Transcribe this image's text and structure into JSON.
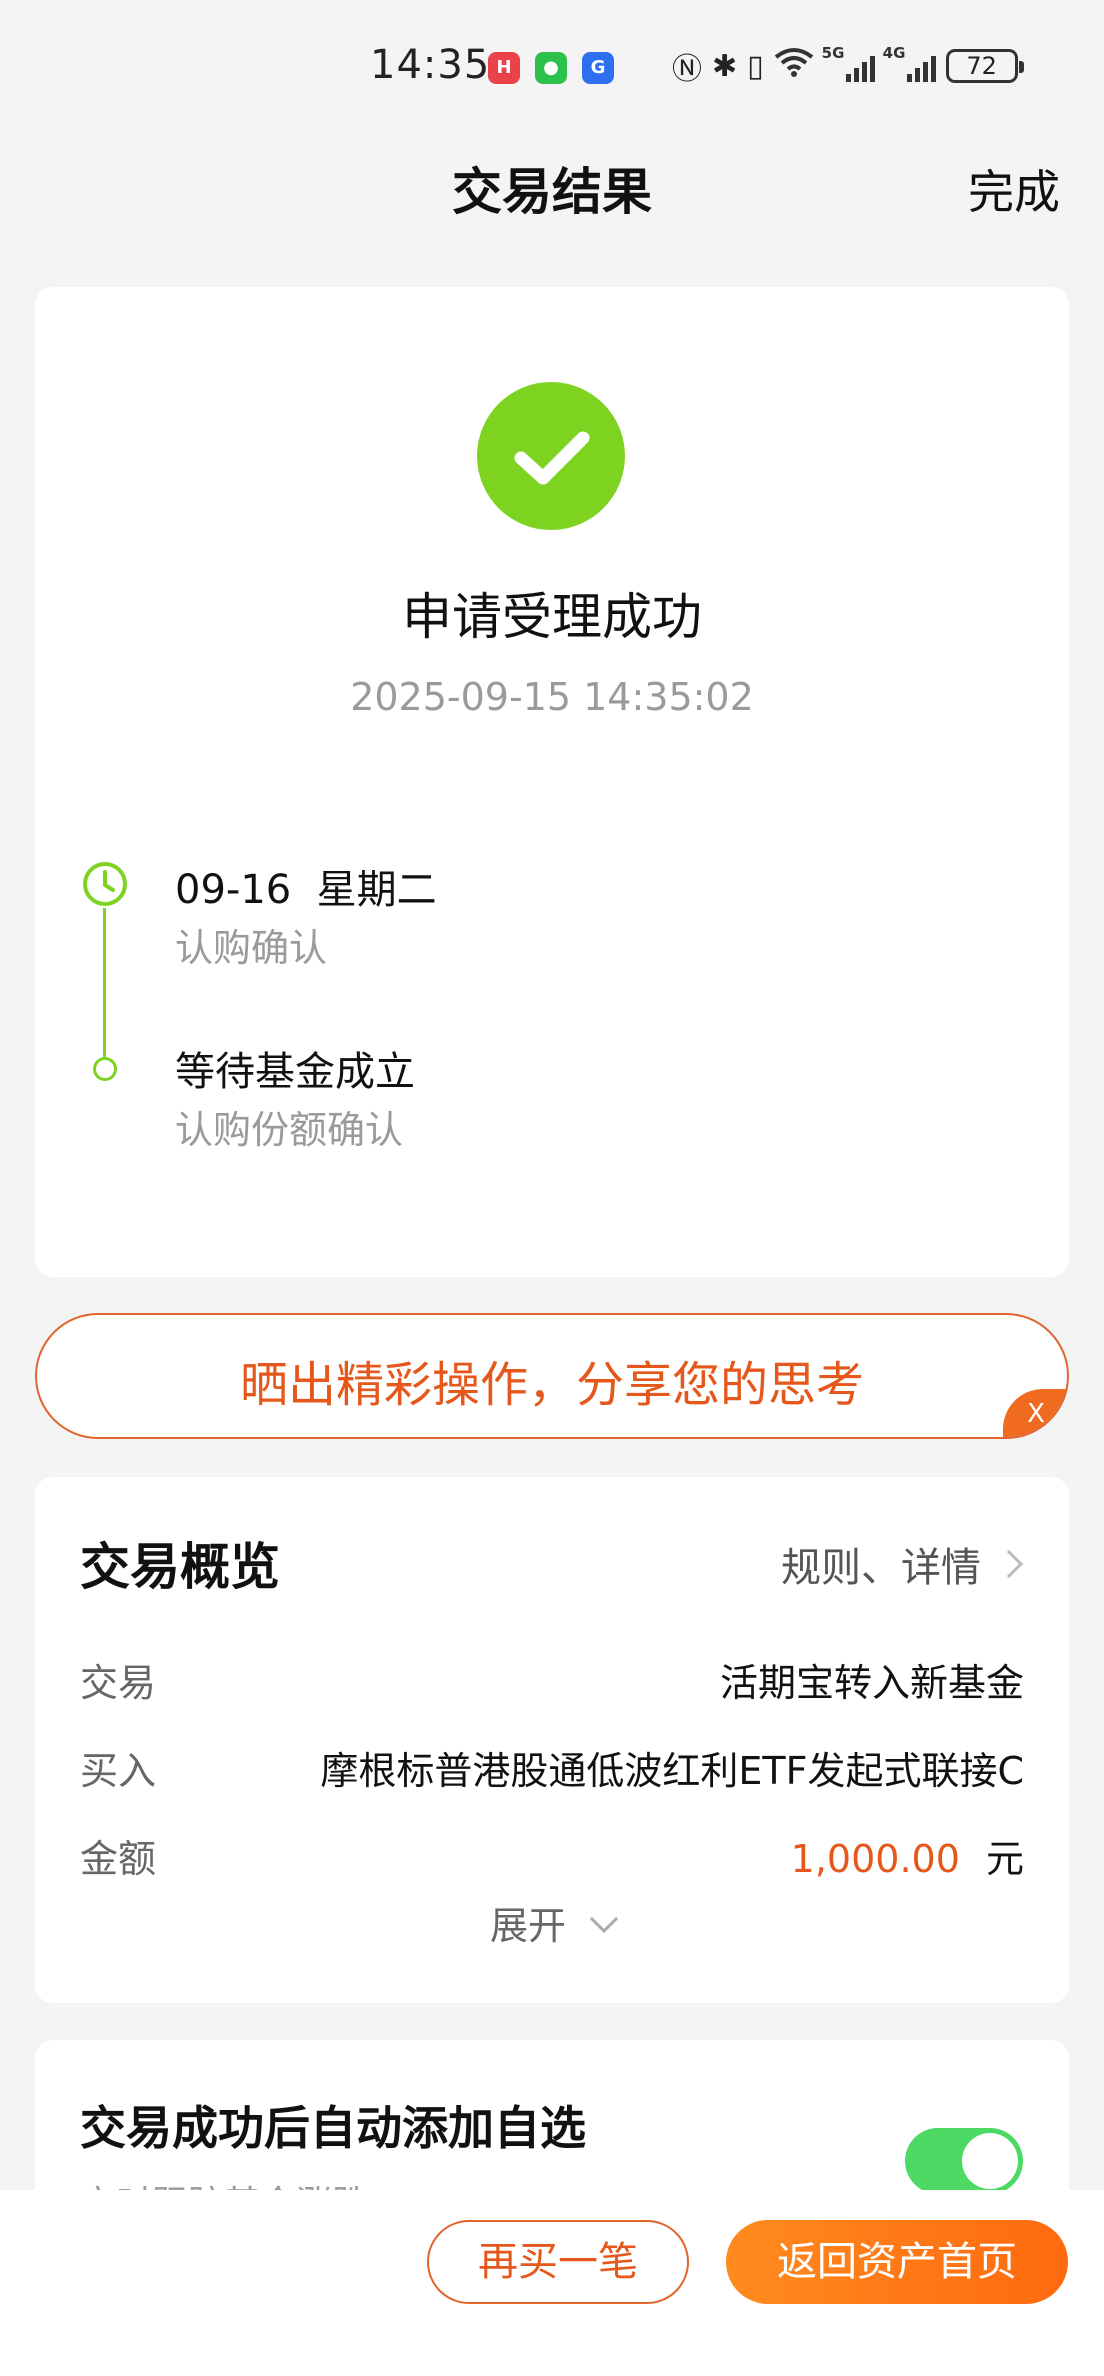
{
  "status_bar": {
    "time": "14:35",
    "apps": [
      "huawei-app-icon",
      "wechat-icon",
      "g-app-icon"
    ],
    "network_5g": "5G",
    "network_4g": "4G",
    "battery": "72"
  },
  "header": {
    "title": "交易结果",
    "done_label": "完成"
  },
  "result": {
    "status": "申请受理成功",
    "timestamp": "2025-09-15 14:35:02",
    "timeline": [
      {
        "title": "09-16  星期二",
        "subtitle": "认购确认"
      },
      {
        "title": "等待基金成立",
        "subtitle": "认购份额确认"
      }
    ]
  },
  "share_banner": {
    "text": "晒出精彩操作，分享您的思考",
    "close_label": "X"
  },
  "overview": {
    "title": "交易概览",
    "link_label": "规则、详情",
    "rows": [
      {
        "key": "交易",
        "value": "活期宝转入新基金"
      },
      {
        "key": "买入",
        "value": "摩根标普港股通低波红利ETF发起式联接C"
      },
      {
        "key": "金额",
        "amount": "1,000.00",
        "unit": "元"
      }
    ],
    "expand_label": "展开"
  },
  "auto_add": {
    "title": "交易成功后自动添加自选",
    "subtitle": "实时跟踪基金涨跌",
    "enabled": true
  },
  "actions": {
    "buy_again": "再买一笔",
    "return_home": "返回资产首页"
  },
  "colors": {
    "accent_orange": "#e5571a",
    "success_green": "#7ed321",
    "toggle_green": "#4cd964"
  }
}
